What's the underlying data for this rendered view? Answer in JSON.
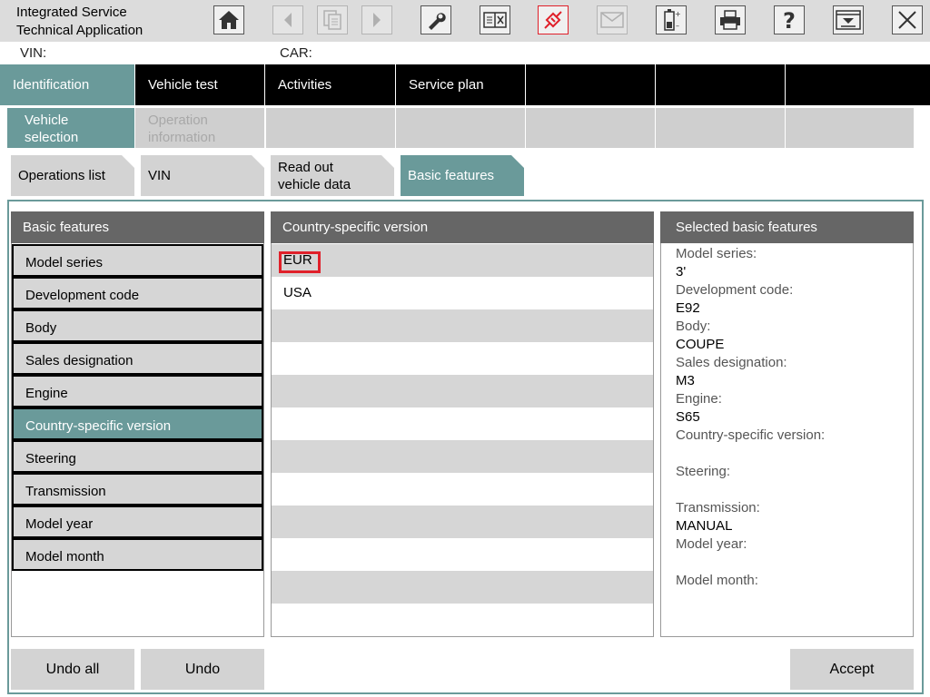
{
  "app": {
    "title_line1": "Integrated Service",
    "title_line2": "Technical Application"
  },
  "toolbar": {
    "buttons": [
      {
        "icon": "home-icon",
        "enabled": true
      },
      {
        "icon": "back-arrow-icon",
        "enabled": false
      },
      {
        "icon": "documents-icon",
        "enabled": false
      },
      {
        "icon": "forward-arrow-icon",
        "enabled": false
      },
      {
        "icon": "wrench-icon",
        "enabled": true
      },
      {
        "icon": "compare-icon",
        "enabled": true
      },
      {
        "icon": "connection-icon",
        "enabled": true,
        "color": "#e0202a"
      },
      {
        "icon": "mail-icon",
        "enabled": false
      },
      {
        "icon": "battery-icon",
        "enabled": true
      },
      {
        "icon": "printer-icon",
        "enabled": true
      },
      {
        "icon": "help-icon",
        "enabled": true
      },
      {
        "icon": "minimize-icon",
        "enabled": true
      },
      {
        "icon": "close-icon",
        "enabled": true
      }
    ]
  },
  "info": {
    "vin_label": "VIN:",
    "car_label": "CAR:"
  },
  "main_nav": [
    {
      "label": "Identification",
      "active": true
    },
    {
      "label": "Vehicle test",
      "active": false
    },
    {
      "label": "Activities",
      "active": false
    },
    {
      "label": "Service plan",
      "active": false
    },
    {
      "label": "",
      "active": false
    },
    {
      "label": "",
      "active": false
    },
    {
      "label": "",
      "active": false
    }
  ],
  "sub_nav": [
    {
      "line1": "Vehicle",
      "line2": "selection",
      "active": true
    },
    {
      "line1": "Operation",
      "line2": "information",
      "active": false
    }
  ],
  "folder_tabs": [
    {
      "line1": "Operations list",
      "line2": "",
      "active": false
    },
    {
      "line1": "VIN",
      "line2": "",
      "active": false
    },
    {
      "line1": "Read out",
      "line2": "vehicle data",
      "active": false
    },
    {
      "line1": "Basic features",
      "line2": "",
      "active": true
    }
  ],
  "left_panel": {
    "header": "Basic features",
    "items": [
      "Model series",
      "Development code",
      "Body",
      "Sales designation",
      "Engine",
      "Country-specific version",
      "Steering",
      "Transmission",
      "Model year",
      "Model month"
    ],
    "selected": "Country-specific version"
  },
  "middle_panel": {
    "header": "Country-specific version",
    "options": [
      "EUR",
      "USA"
    ],
    "highlighted": "EUR"
  },
  "right_panel": {
    "header": "Selected basic features",
    "fields": [
      {
        "label": "Model series:",
        "value": "3'"
      },
      {
        "label": "Development code:",
        "value": "E92"
      },
      {
        "label": "Body:",
        "value": "COUPE"
      },
      {
        "label": "Sales designation:",
        "value": "M3"
      },
      {
        "label": "Engine:",
        "value": "S65"
      },
      {
        "label": "Country-specific version:",
        "value": ""
      },
      {
        "label": "Steering:",
        "value": ""
      },
      {
        "label": "Transmission:",
        "value": "MANUAL"
      },
      {
        "label": "Model year:",
        "value": ""
      },
      {
        "label": "Model month:",
        "value": ""
      }
    ]
  },
  "buttons": {
    "undo_all": "Undo all",
    "undo": "Undo",
    "accept": "Accept"
  },
  "colors": {
    "accent": "#6a9a9a",
    "nav_bg": "#000000",
    "highlight_border": "#e0202a"
  }
}
